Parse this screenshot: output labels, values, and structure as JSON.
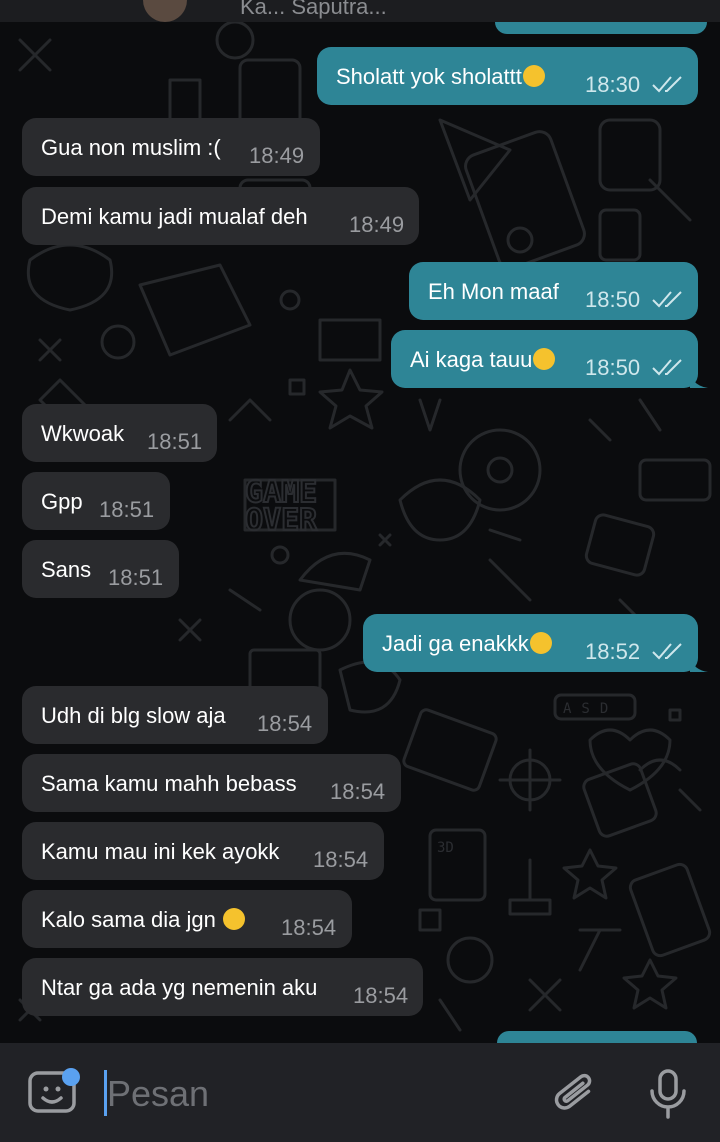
{
  "header": {
    "contact_name": "Ka... Saputra..."
  },
  "messages": [
    {
      "dir": "out",
      "text": "Sholatt yok sholattt",
      "emoji": "joy-emoji",
      "time": "18:30",
      "read": true
    },
    {
      "dir": "in",
      "text": "Gua non muslim :(",
      "time": "18:49"
    },
    {
      "dir": "in",
      "text": "Demi kamu jadi mualaf deh",
      "time": "18:49"
    },
    {
      "dir": "out",
      "text": "Eh Mon maaf",
      "time": "18:50",
      "read": true
    },
    {
      "dir": "out",
      "text": "Ai kaga tauu",
      "emoji": "sob-emoji",
      "time": "18:50",
      "read": true
    },
    {
      "dir": "in",
      "text": "Wkwoak",
      "time": "18:51"
    },
    {
      "dir": "in",
      "text": "Gpp",
      "time": "18:51"
    },
    {
      "dir": "in",
      "text": "Sans",
      "time": "18:51"
    },
    {
      "dir": "out",
      "text": "Jadi ga enakkk",
      "emoji": "sob-emoji",
      "time": "18:52",
      "read": true
    },
    {
      "dir": "in",
      "text": "Udh di blg slow aja",
      "time": "18:54"
    },
    {
      "dir": "in",
      "text": "Sama kamu mahh bebass",
      "time": "18:54"
    },
    {
      "dir": "in",
      "text": "Kamu mau ini kek ayokk",
      "time": "18:54"
    },
    {
      "dir": "in",
      "text": "Kalo sama dia jgn",
      "emoji": "pleading-emoji",
      "time": "18:54"
    },
    {
      "dir": "in",
      "text": "Ntar ga ada yg nemenin aku",
      "time": "18:54"
    }
  ],
  "input": {
    "placeholder": "Pesan",
    "sticker_icon": "sticker-icon",
    "attach_icon": "paperclip-icon",
    "mic_icon": "microphone-icon"
  },
  "background": {
    "doodle_text_1": "GAME",
    "doodle_text_2": "OVER",
    "doodle_keys": "ASD",
    "doodle_3d": "3D"
  },
  "colors": {
    "background": "#0b0c0e",
    "incoming_bubble": "#2a2b2e",
    "outgoing_bubble": "#2e8596",
    "input_bar": "#212226",
    "accent": "#5aa1f0"
  }
}
